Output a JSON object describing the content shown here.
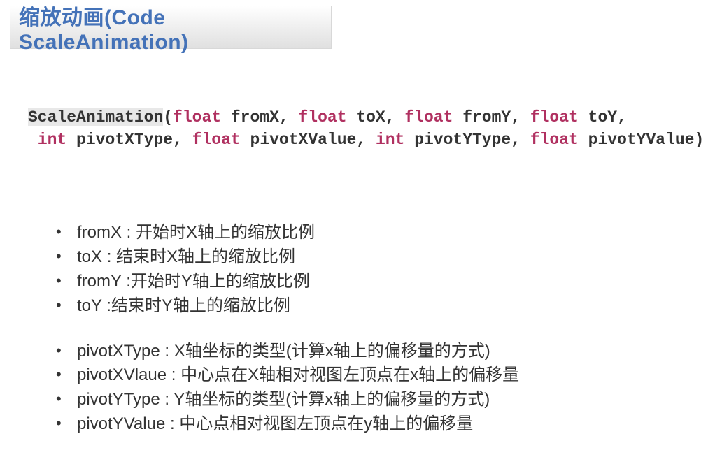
{
  "title": "缩放动画(Code ScaleAnimation)",
  "code": {
    "className": "ScaleAnimation",
    "line1": {
      "p1_type": "float",
      "p1_name": "fromX",
      "p2_type": "float",
      "p2_name": "toX",
      "p3_type": "float",
      "p3_name": "fromY",
      "p4_type": "float",
      "p4_name": "toY"
    },
    "line2": {
      "p1_type": "int",
      "p1_name": "pivotXType",
      "p2_type": "float",
      "p2_name": "pivotXValue",
      "p3_type": "int",
      "p3_name": "pivotYType",
      "p4_type": "float",
      "p4_name": "pivotYValue"
    }
  },
  "descriptions": {
    "group1": [
      "fromX : 开始时X轴上的缩放比例",
      "toX : 结束时X轴上的缩放比例",
      "fromY :开始时Y轴上的缩放比例",
      "toY :结束时Y轴上的缩放比例"
    ],
    "group2": [
      "pivotXType : X轴坐标的类型(计算x轴上的偏移量的方式)",
      "pivotXVlaue : 中心点在X轴相对视图左顶点在x轴上的偏移量",
      "pivotYType : Y轴坐标的类型(计算x轴上的偏移量的方式)",
      "pivotYValue : 中心点相对视图左顶点在y轴上的偏移量"
    ]
  }
}
